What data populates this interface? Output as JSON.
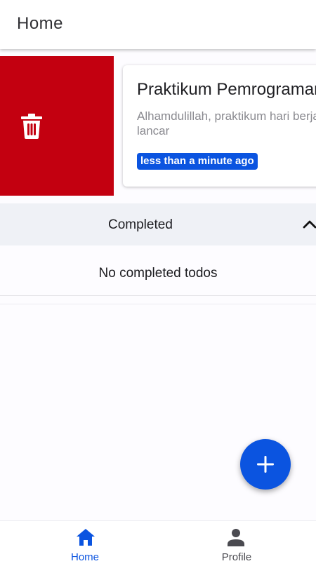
{
  "appbar": {
    "title": "Home"
  },
  "todo": {
    "title": "Praktikum Pemrograman",
    "description_line1": "Alhamdulillah, praktikum hari berjalan",
    "description_line2": "lancar",
    "time": "less than a minute ago",
    "delete_icon": "trash-icon"
  },
  "completed": {
    "header_label": "Completed",
    "expand_icon": "chevron-up-icon",
    "empty_message": "No completed todos"
  },
  "fab": {
    "icon": "plus-icon"
  },
  "bottom_nav": {
    "items": [
      {
        "label": "Home",
        "icon": "home-icon",
        "active": true
      },
      {
        "label": "Profile",
        "icon": "person-icon",
        "active": false
      }
    ]
  },
  "colors": {
    "accent": "#0b54e0",
    "delete": "#c30010",
    "section_bg": "#eff1f6"
  }
}
